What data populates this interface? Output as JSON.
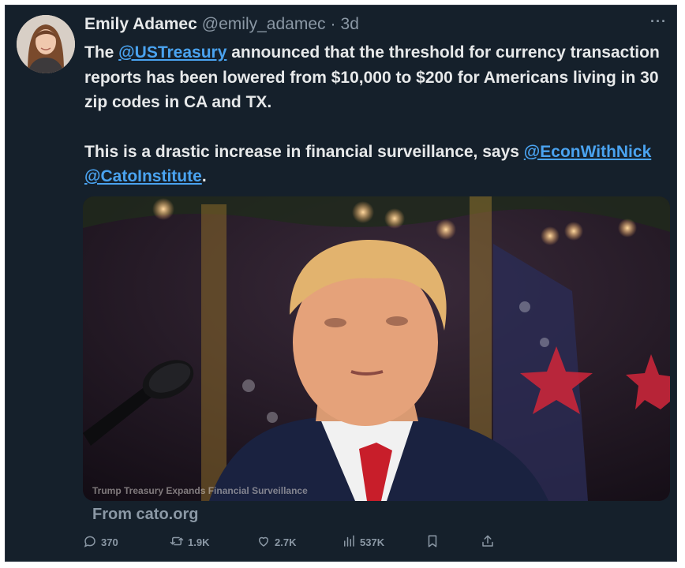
{
  "tweet": {
    "author": {
      "name": "Emily Adamec",
      "handle": "@emily_adamec",
      "separator": "·",
      "time": "3d"
    },
    "more_label": "···",
    "paragraph1": {
      "prefix": "The ",
      "mention": "@USTreasury",
      "suffix": " announced that the threshold for currency transaction reports has been lowered from $10,000 to $200 for Americans living in 30 zip codes in CA and TX."
    },
    "paragraph2": {
      "prefix": "This is a drastic increase in financial surveillance, says ",
      "mention1": "@EconWithNick",
      "space": " ",
      "mention2": "@CatoInstitute",
      "suffix": "."
    },
    "card": {
      "image_caption": "Trump Treasury Expands Financial Surveillance",
      "source": "From cato.org"
    },
    "actions": {
      "replies": "370",
      "retweets": "1.9K",
      "likes": "2.7K",
      "views": "537K"
    }
  },
  "colors": {
    "background": "#15202b",
    "text": "#e7e9ea",
    "muted": "#8b98a5",
    "link": "#4aa3f0"
  },
  "icons": [
    "reply-icon",
    "retweet-icon",
    "like-icon",
    "views-icon",
    "bookmark-icon",
    "share-icon",
    "more-icon"
  ]
}
